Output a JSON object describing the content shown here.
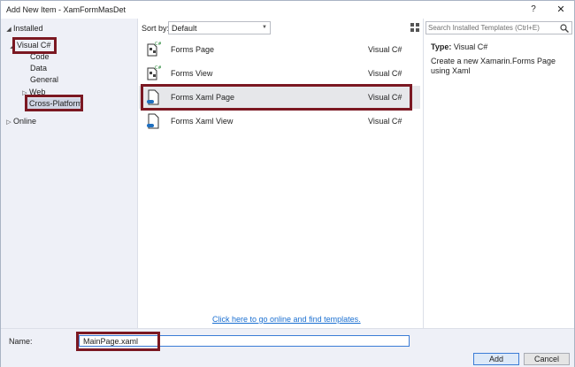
{
  "window": {
    "title": "Add New Item - XamFormMasDet",
    "help_glyph": "?",
    "close_glyph": "✕"
  },
  "tree": {
    "installed": "Installed",
    "visual_csharp": "Visual C#",
    "children": [
      "Code",
      "Data",
      "General",
      "Web",
      "Cross-Platform"
    ],
    "online": "Online"
  },
  "sort": {
    "label": "Sort by:",
    "value": "Default"
  },
  "templates": [
    {
      "name": "Forms Page",
      "lang": "Visual C#",
      "icon": "forms-page-icon"
    },
    {
      "name": "Forms View",
      "lang": "Visual C#",
      "icon": "forms-view-icon"
    },
    {
      "name": "Forms Xaml Page",
      "lang": "Visual C#",
      "icon": "forms-xaml-page-icon",
      "selected": true
    },
    {
      "name": "Forms Xaml View",
      "lang": "Visual C#",
      "icon": "forms-xaml-view-icon"
    }
  ],
  "online_link": "Click here to go online and find templates.",
  "search": {
    "placeholder": "Search Installed Templates (Ctrl+E)"
  },
  "details": {
    "type_label": "Type:",
    "type_value": "Visual C#",
    "description": "Create a new Xamarin.Forms Page using Xaml"
  },
  "footer": {
    "name_label": "Name:",
    "name_value": "MainPage.xaml",
    "add_label": "Add",
    "cancel_label": "Cancel"
  },
  "colors": {
    "highlight": "#7b1822",
    "link": "#1a6fd1",
    "pane_bg": "#eef0f7"
  }
}
